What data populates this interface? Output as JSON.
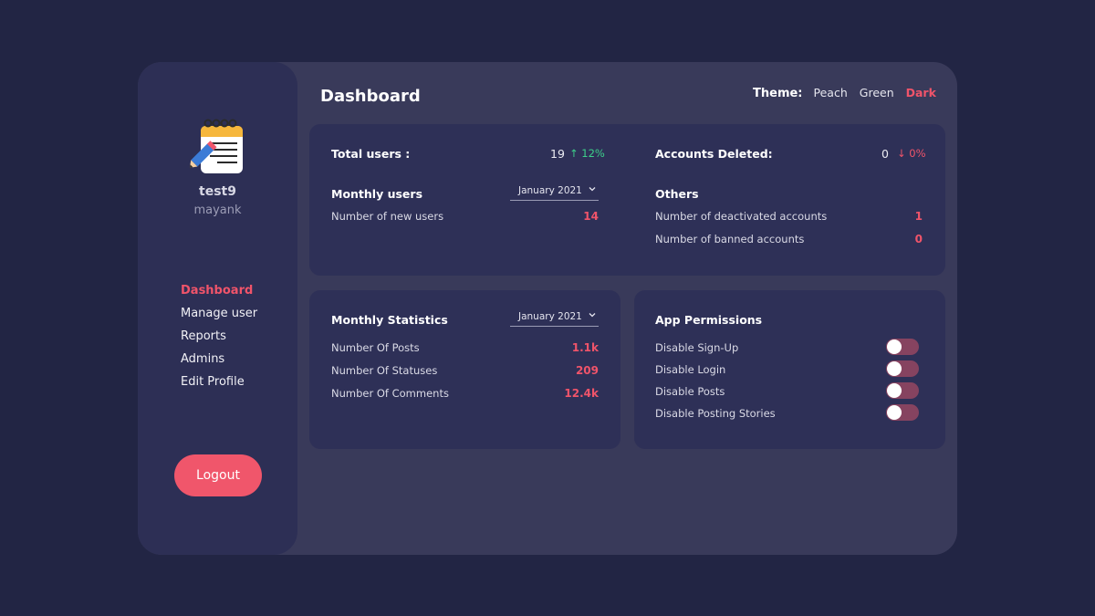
{
  "header": {
    "title": "Dashboard"
  },
  "theme": {
    "label": "Theme:",
    "options": [
      "Peach",
      "Green",
      "Dark"
    ],
    "selected": "Dark"
  },
  "profile": {
    "name": "test9",
    "handle": "mayank",
    "avatar_icon": "notepad-pencil-icon"
  },
  "sidebar": {
    "items": [
      {
        "label": "Dashboard",
        "active": true
      },
      {
        "label": "Manage user",
        "active": false
      },
      {
        "label": "Reports",
        "active": false
      },
      {
        "label": "Admins",
        "active": false
      },
      {
        "label": "Edit Profile",
        "active": false
      }
    ],
    "logout_label": "Logout"
  },
  "summary": {
    "total_users": {
      "label": "Total users :",
      "value": "19",
      "change": "↑ 12%"
    },
    "accounts_deleted": {
      "label": "Accounts Deleted:",
      "value": "0",
      "change": "↓ 0%"
    },
    "monthly_users": {
      "title": "Monthly users",
      "month": "January 2021",
      "rows": [
        {
          "label": "Number of new users",
          "value": "14"
        }
      ]
    },
    "others": {
      "title": "Others",
      "rows": [
        {
          "label": "Number of deactivated accounts",
          "value": "1"
        },
        {
          "label": "Number of banned accounts",
          "value": "0"
        }
      ]
    }
  },
  "monthly_statistics": {
    "title": "Monthly Statistics",
    "month": "January 2021",
    "rows": [
      {
        "label": "Number Of Posts",
        "value": "1.1k"
      },
      {
        "label": "Number Of Statuses",
        "value": "209"
      },
      {
        "label": "Number Of Comments",
        "value": "12.4k"
      }
    ]
  },
  "app_permissions": {
    "title": "App Permissions",
    "items": [
      {
        "label": "Disable Sign-Up",
        "enabled": false
      },
      {
        "label": "Disable Login",
        "enabled": false
      },
      {
        "label": "Disable Posts",
        "enabled": false
      },
      {
        "label": "Disable Posting Stories",
        "enabled": false
      }
    ]
  },
  "colors": {
    "background": "#222544",
    "panel": "#393a5a",
    "sidebar": "#2d2f55",
    "card": "#2e3057",
    "accent": "#f0546a",
    "positive": "#3dd08a",
    "toggle_track": "#864360"
  }
}
